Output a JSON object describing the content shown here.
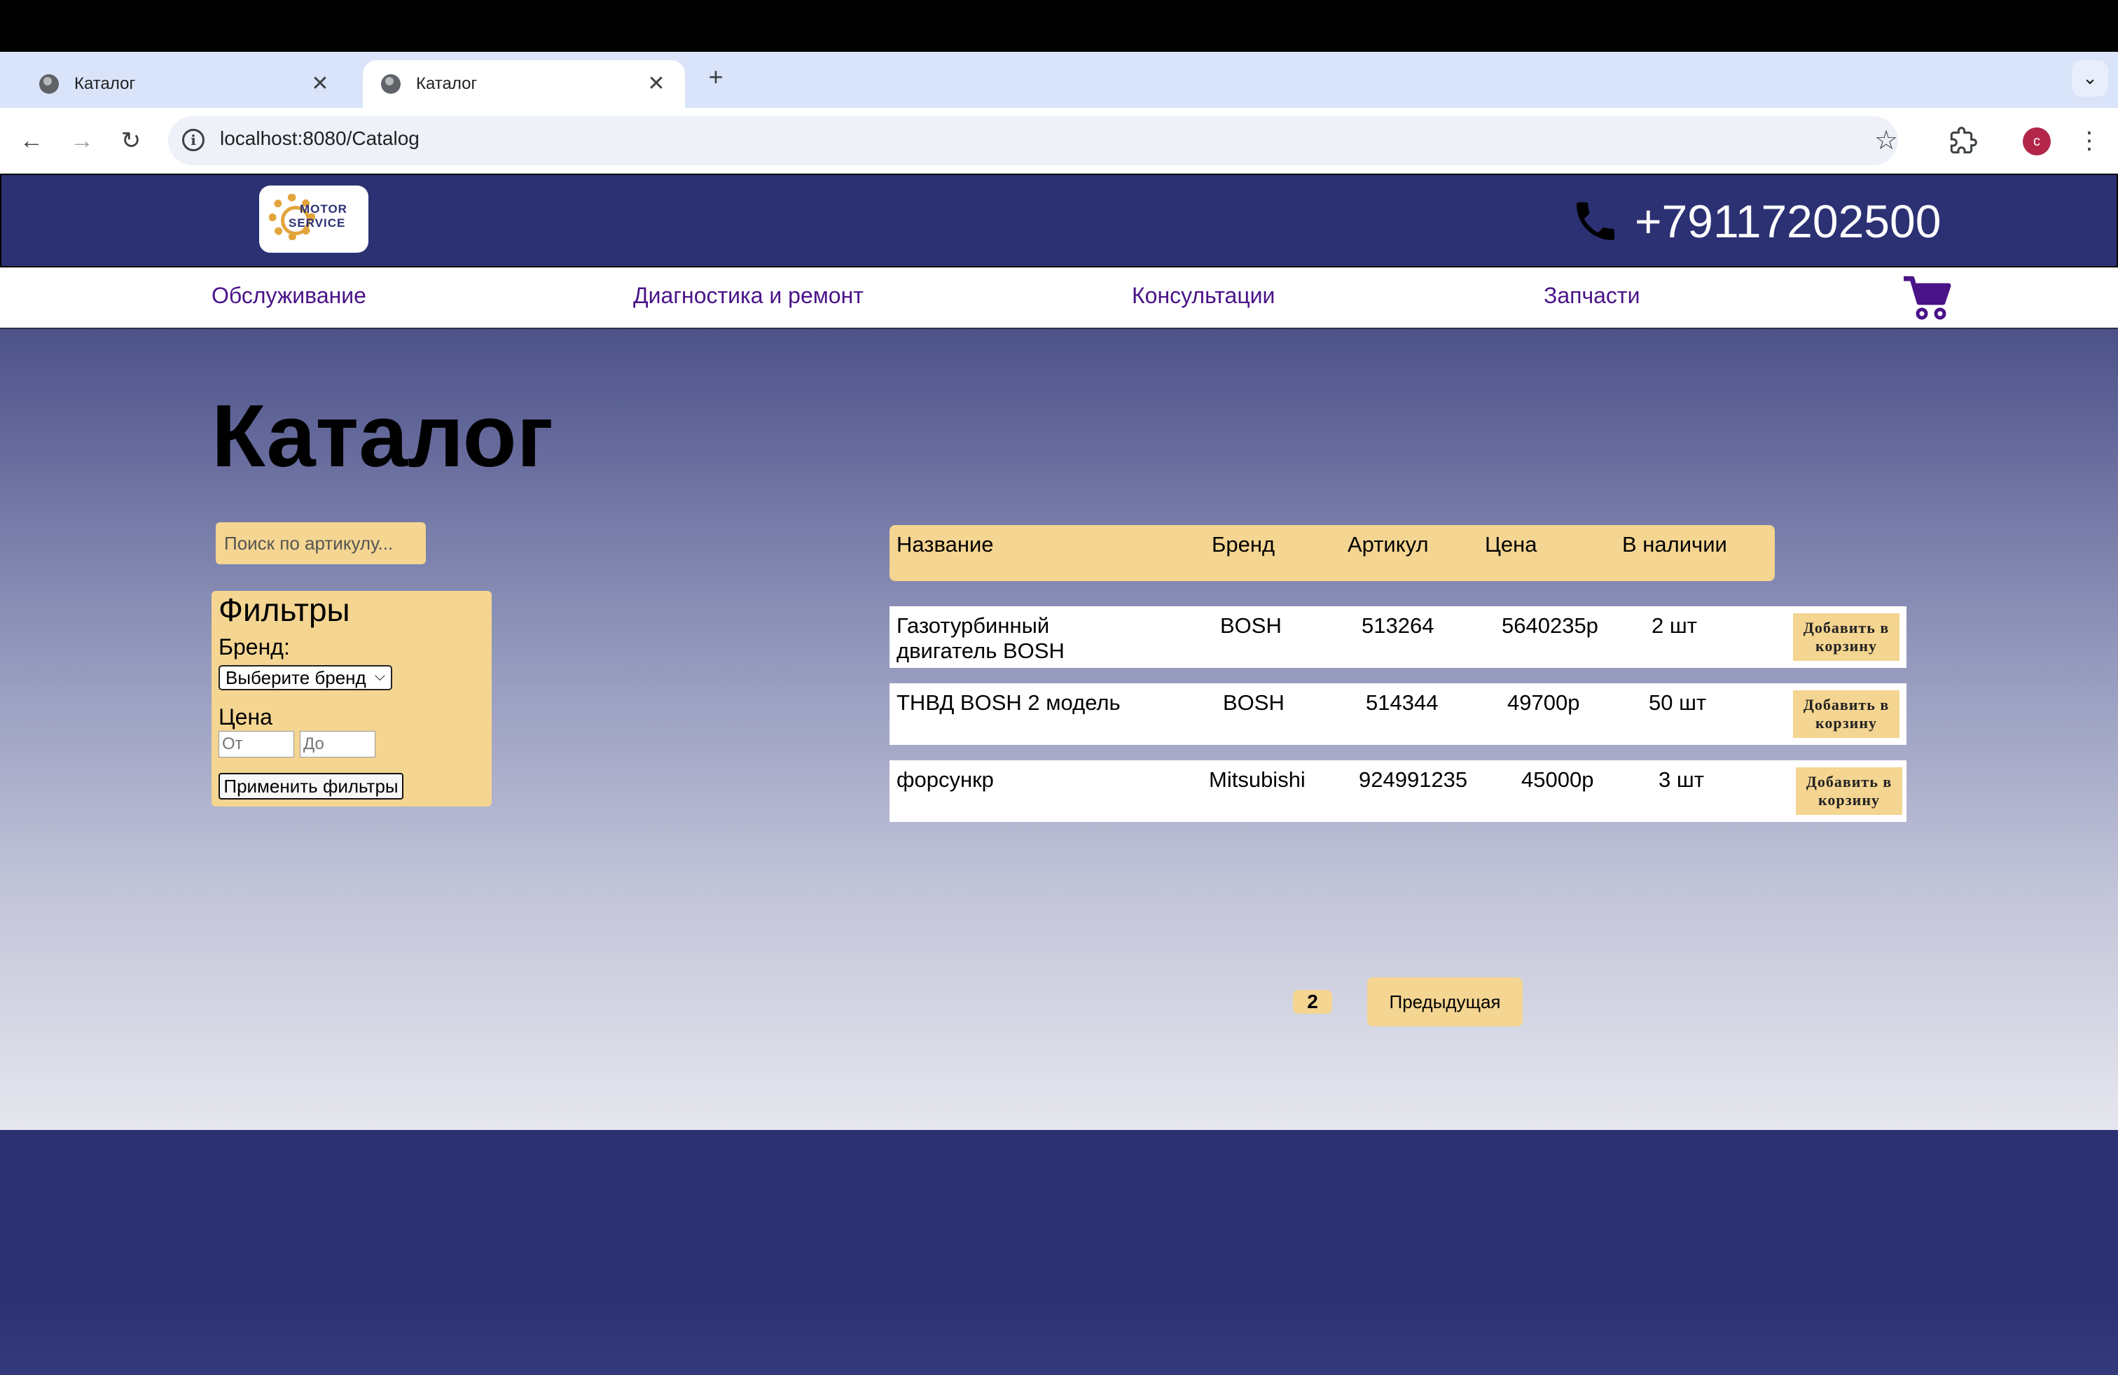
{
  "browser": {
    "tabs": [
      {
        "title": "Каталог",
        "active": false
      },
      {
        "title": "Каталог",
        "active": true
      }
    ],
    "tab_close_glyph": "✕",
    "new_tab_glyph": "+",
    "tab_menu_glyph": "⌄",
    "url": "localhost:8080/Catalog",
    "profile_initial": "c",
    "icons": [
      "back-arrow-icon",
      "forward-arrow-icon",
      "reload-icon",
      "site-info-icon",
      "bookmark-star-icon",
      "extensions-icon",
      "kebab-menu-icon"
    ]
  },
  "site": {
    "logo": {
      "line1": "MOTOR",
      "line2": "SERVICE"
    },
    "phone": "+79117202500",
    "nav": [
      "Обслуживание",
      "Диагностика и ремонт",
      "Консультации",
      "Запчасти"
    ],
    "colors": {
      "header": "#2c3174",
      "accent": "#f4d591",
      "nav_text": "#4a1388"
    }
  },
  "catalog": {
    "title": "Каталог",
    "search_placeholder": "Поиск по артикулу...",
    "filters": {
      "title": "Фильтры",
      "brand_label": "Бренд:",
      "brand_selected": "Выберите бренд",
      "price_label": "Цена",
      "price_from_placeholder": "От",
      "price_to_placeholder": "До",
      "apply_label": "Применить фильтры"
    },
    "columns": [
      "Название",
      "Бренд",
      "Артикул",
      "Цена",
      "В наличии"
    ],
    "rows": [
      {
        "name": "Газотурбинный двигатель BOSH",
        "brand": "BOSH",
        "article": "513264",
        "price": "5640235р",
        "stock": "2 шт",
        "button": "Добавить в корзину"
      },
      {
        "name": "ТНВД BOSH 2 модель",
        "brand": "BOSH",
        "article": "514344",
        "price": "49700р",
        "stock": "50 шт",
        "button": "Добавить в корзину"
      },
      {
        "name": "форсункр",
        "brand": "Mitsubishi",
        "article": "924991235",
        "price": "45000р",
        "stock": "3 шт",
        "button": "Добавить в корзину"
      }
    ],
    "pagination": {
      "current_page": "2",
      "prev_label": "Предыдущая"
    }
  }
}
